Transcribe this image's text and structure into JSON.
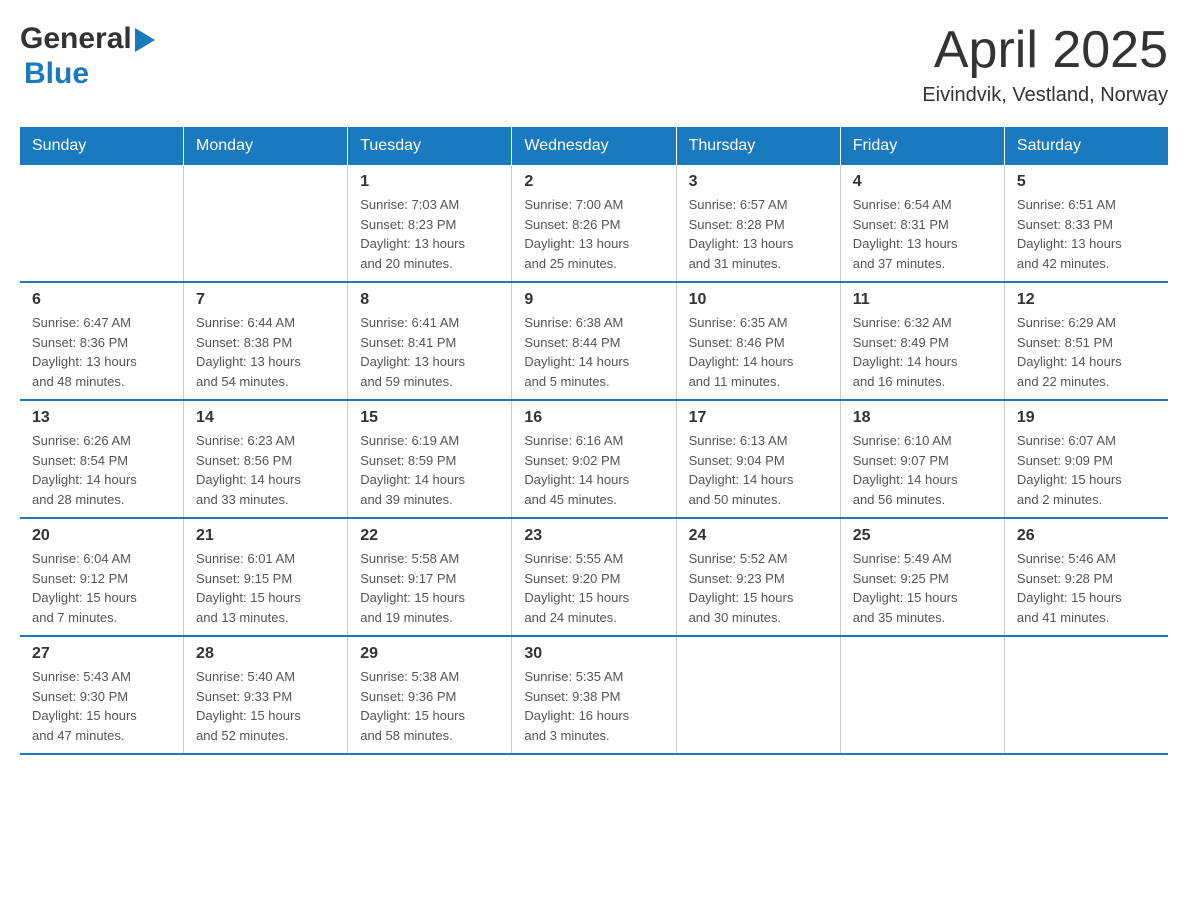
{
  "header": {
    "logo_general": "General",
    "logo_blue": "Blue",
    "month_year": "April 2025",
    "location": "Eivindvik, Vestland, Norway"
  },
  "weekdays": [
    "Sunday",
    "Monday",
    "Tuesday",
    "Wednesday",
    "Thursday",
    "Friday",
    "Saturday"
  ],
  "weeks": [
    [
      {
        "day": "",
        "info": ""
      },
      {
        "day": "",
        "info": ""
      },
      {
        "day": "1",
        "info": "Sunrise: 7:03 AM\nSunset: 8:23 PM\nDaylight: 13 hours\nand 20 minutes."
      },
      {
        "day": "2",
        "info": "Sunrise: 7:00 AM\nSunset: 8:26 PM\nDaylight: 13 hours\nand 25 minutes."
      },
      {
        "day": "3",
        "info": "Sunrise: 6:57 AM\nSunset: 8:28 PM\nDaylight: 13 hours\nand 31 minutes."
      },
      {
        "day": "4",
        "info": "Sunrise: 6:54 AM\nSunset: 8:31 PM\nDaylight: 13 hours\nand 37 minutes."
      },
      {
        "day": "5",
        "info": "Sunrise: 6:51 AM\nSunset: 8:33 PM\nDaylight: 13 hours\nand 42 minutes."
      }
    ],
    [
      {
        "day": "6",
        "info": "Sunrise: 6:47 AM\nSunset: 8:36 PM\nDaylight: 13 hours\nand 48 minutes."
      },
      {
        "day": "7",
        "info": "Sunrise: 6:44 AM\nSunset: 8:38 PM\nDaylight: 13 hours\nand 54 minutes."
      },
      {
        "day": "8",
        "info": "Sunrise: 6:41 AM\nSunset: 8:41 PM\nDaylight: 13 hours\nand 59 minutes."
      },
      {
        "day": "9",
        "info": "Sunrise: 6:38 AM\nSunset: 8:44 PM\nDaylight: 14 hours\nand 5 minutes."
      },
      {
        "day": "10",
        "info": "Sunrise: 6:35 AM\nSunset: 8:46 PM\nDaylight: 14 hours\nand 11 minutes."
      },
      {
        "day": "11",
        "info": "Sunrise: 6:32 AM\nSunset: 8:49 PM\nDaylight: 14 hours\nand 16 minutes."
      },
      {
        "day": "12",
        "info": "Sunrise: 6:29 AM\nSunset: 8:51 PM\nDaylight: 14 hours\nand 22 minutes."
      }
    ],
    [
      {
        "day": "13",
        "info": "Sunrise: 6:26 AM\nSunset: 8:54 PM\nDaylight: 14 hours\nand 28 minutes."
      },
      {
        "day": "14",
        "info": "Sunrise: 6:23 AM\nSunset: 8:56 PM\nDaylight: 14 hours\nand 33 minutes."
      },
      {
        "day": "15",
        "info": "Sunrise: 6:19 AM\nSunset: 8:59 PM\nDaylight: 14 hours\nand 39 minutes."
      },
      {
        "day": "16",
        "info": "Sunrise: 6:16 AM\nSunset: 9:02 PM\nDaylight: 14 hours\nand 45 minutes."
      },
      {
        "day": "17",
        "info": "Sunrise: 6:13 AM\nSunset: 9:04 PM\nDaylight: 14 hours\nand 50 minutes."
      },
      {
        "day": "18",
        "info": "Sunrise: 6:10 AM\nSunset: 9:07 PM\nDaylight: 14 hours\nand 56 minutes."
      },
      {
        "day": "19",
        "info": "Sunrise: 6:07 AM\nSunset: 9:09 PM\nDaylight: 15 hours\nand 2 minutes."
      }
    ],
    [
      {
        "day": "20",
        "info": "Sunrise: 6:04 AM\nSunset: 9:12 PM\nDaylight: 15 hours\nand 7 minutes."
      },
      {
        "day": "21",
        "info": "Sunrise: 6:01 AM\nSunset: 9:15 PM\nDaylight: 15 hours\nand 13 minutes."
      },
      {
        "day": "22",
        "info": "Sunrise: 5:58 AM\nSunset: 9:17 PM\nDaylight: 15 hours\nand 19 minutes."
      },
      {
        "day": "23",
        "info": "Sunrise: 5:55 AM\nSunset: 9:20 PM\nDaylight: 15 hours\nand 24 minutes."
      },
      {
        "day": "24",
        "info": "Sunrise: 5:52 AM\nSunset: 9:23 PM\nDaylight: 15 hours\nand 30 minutes."
      },
      {
        "day": "25",
        "info": "Sunrise: 5:49 AM\nSunset: 9:25 PM\nDaylight: 15 hours\nand 35 minutes."
      },
      {
        "day": "26",
        "info": "Sunrise: 5:46 AM\nSunset: 9:28 PM\nDaylight: 15 hours\nand 41 minutes."
      }
    ],
    [
      {
        "day": "27",
        "info": "Sunrise: 5:43 AM\nSunset: 9:30 PM\nDaylight: 15 hours\nand 47 minutes."
      },
      {
        "day": "28",
        "info": "Sunrise: 5:40 AM\nSunset: 9:33 PM\nDaylight: 15 hours\nand 52 minutes."
      },
      {
        "day": "29",
        "info": "Sunrise: 5:38 AM\nSunset: 9:36 PM\nDaylight: 15 hours\nand 58 minutes."
      },
      {
        "day": "30",
        "info": "Sunrise: 5:35 AM\nSunset: 9:38 PM\nDaylight: 16 hours\nand 3 minutes."
      },
      {
        "day": "",
        "info": ""
      },
      {
        "day": "",
        "info": ""
      },
      {
        "day": "",
        "info": ""
      }
    ]
  ]
}
